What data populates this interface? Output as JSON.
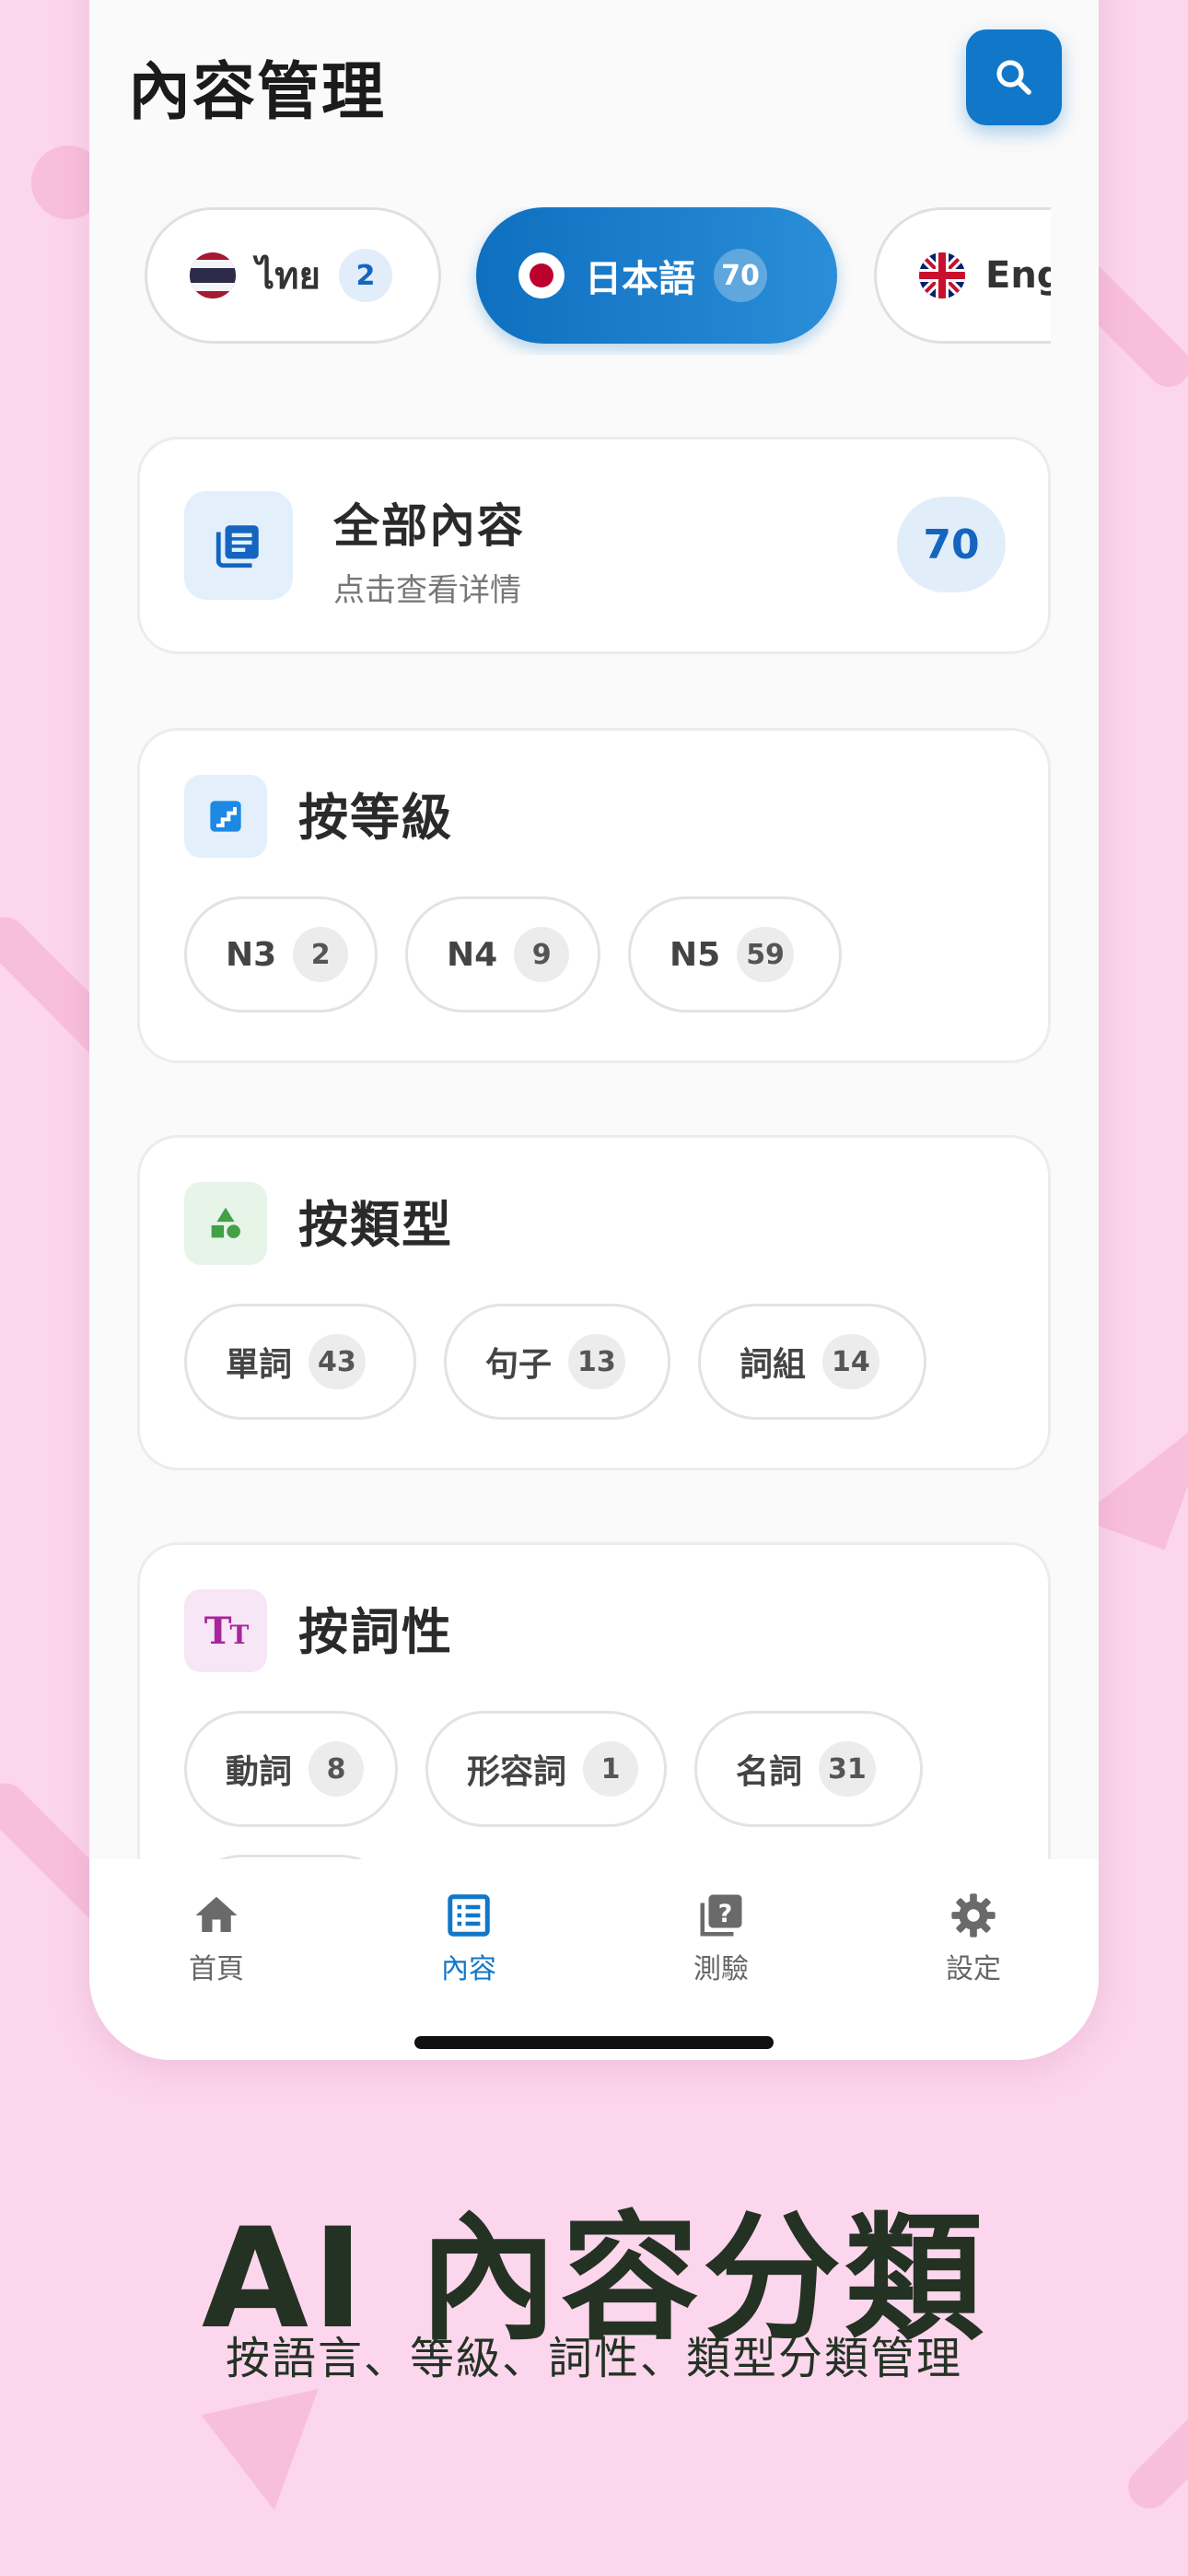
{
  "header": {
    "title": "內容管理",
    "search_icon": "search-icon"
  },
  "languages": [
    {
      "flag": "thailand",
      "name": "ไทย",
      "count": "2",
      "active": false
    },
    {
      "flag": "japan",
      "name": "日本語",
      "count": "70",
      "active": true
    },
    {
      "flag": "uk",
      "name": "Eng",
      "count": "",
      "active": false
    }
  ],
  "all_content": {
    "title": "全部內容",
    "subtitle": "点击查看详情",
    "count": "70"
  },
  "by_level": {
    "title": "按等級",
    "chips": [
      {
        "label": "N3",
        "count": "2"
      },
      {
        "label": "N4",
        "count": "9"
      },
      {
        "label": "N5",
        "count": "59"
      }
    ]
  },
  "by_type": {
    "title": "按類型",
    "chips": [
      {
        "label": "單詞",
        "count": "43"
      },
      {
        "label": "句子",
        "count": "13"
      },
      {
        "label": "詞組",
        "count": "14"
      }
    ]
  },
  "by_pos": {
    "title": "按詞性",
    "chips": [
      {
        "label": "動詞",
        "count": "8"
      },
      {
        "label": "形容詞",
        "count": "1"
      },
      {
        "label": "名詞",
        "count": "31"
      }
    ]
  },
  "nav": [
    {
      "label": "首頁",
      "icon": "home-icon",
      "active": false
    },
    {
      "label": "內容",
      "icon": "list-icon",
      "active": true
    },
    {
      "label": "測驗",
      "icon": "quiz-icon",
      "active": false
    },
    {
      "label": "設定",
      "icon": "gear-icon",
      "active": false
    }
  ],
  "promo": {
    "title": "AI 內容分類",
    "subtitle": "按語言、等級、詞性、類型分類管理"
  },
  "colors": {
    "accent": "#1177c8",
    "background": "#fcd6ec",
    "promo_text": "#243224"
  }
}
